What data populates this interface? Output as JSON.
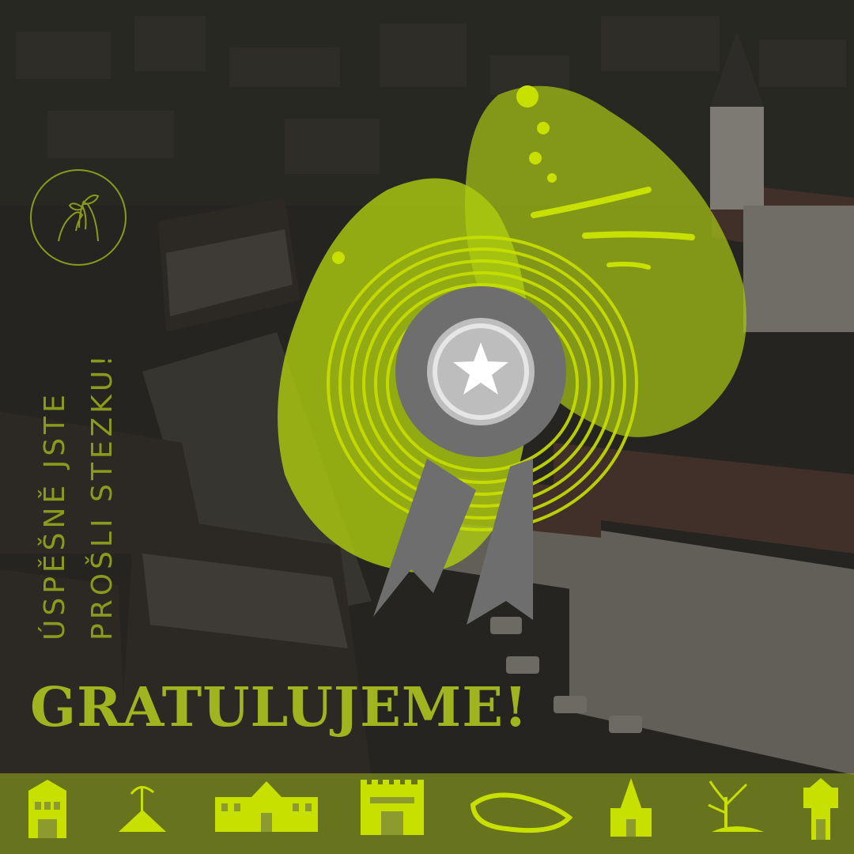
{
  "message": {
    "line1": "ÚSPĚŠNĚ JSTE",
    "line2": "PROŠLI STEZKU!"
  },
  "headline": "GRATULUJEME!",
  "colors": {
    "accent": "#a0b41f",
    "accent_light": "#c8e000",
    "medal_gray": "#6e6e6e",
    "medal_light": "#bdbdbd",
    "background_dark": "#2b2a25"
  },
  "icons": [
    "hands-with-sprout-icon",
    "star-medal-icon",
    "townhouse-icon",
    "tree-on-hill-icon",
    "chateau-icon",
    "castle-gate-icon",
    "pond-icon",
    "church-icon",
    "bare-tree-icon",
    "water-tower-icon"
  ]
}
